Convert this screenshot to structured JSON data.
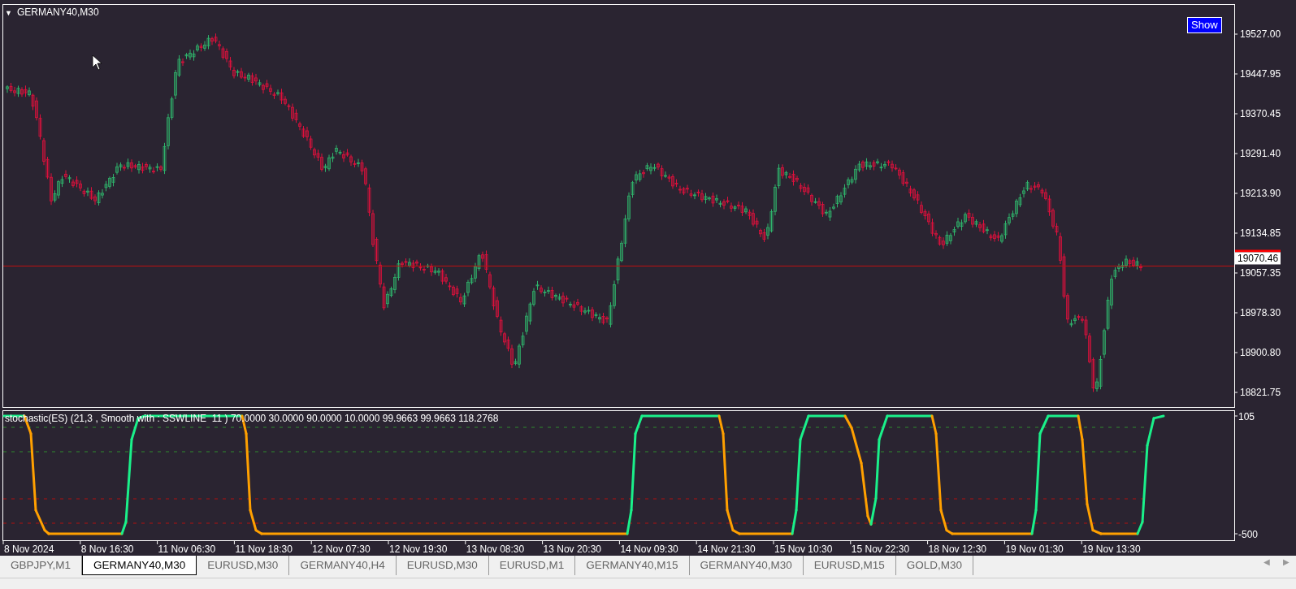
{
  "chart": {
    "collapse_glyph": "▼",
    "symbol_label": "GERMANY40,M30",
    "show_button": "Show",
    "price_ticks": [
      "19527.00",
      "19447.95",
      "19370.45",
      "19291.40",
      "19213.90",
      "19134.85",
      "19057.35",
      "18978.30",
      "18900.80",
      "18821.75"
    ],
    "current_price": "19070.46",
    "indicator": {
      "label": "stochastic(ES) (21,3 , Smooth with : SSWLINE  11 ) 70.0000 30.0000 90.0000 10.0000 99.9663 99.9663 118.2768",
      "ticks": [
        "105",
        "-500"
      ]
    },
    "time_ticks": [
      "8 Nov 2024",
      "8 Nov 16:30",
      "11 Nov 06:30",
      "11 Nov 18:30",
      "12 Nov 07:30",
      "12 Nov 19:30",
      "13 Nov 08:30",
      "13 Nov 20:30",
      "14 Nov 09:30",
      "14 Nov 21:30",
      "15 Nov 10:30",
      "15 Nov 22:30",
      "18 Nov 12:30",
      "19 Nov 01:30",
      "19 Nov 13:30"
    ]
  },
  "tabs": [
    {
      "label": "GBPJPY,M1",
      "selected": false
    },
    {
      "label": "GERMANY40,M30",
      "selected": true
    },
    {
      "label": "EURUSD,M30",
      "selected": false
    },
    {
      "label": "GERMANY40,H4",
      "selected": false
    },
    {
      "label": "EURUSD,M30",
      "selected": false
    },
    {
      "label": "EURUSD,M1",
      "selected": false
    },
    {
      "label": "GERMANY40,M15",
      "selected": false
    },
    {
      "label": "GERMANY40,M30",
      "selected": false
    },
    {
      "label": "EURUSD,M15",
      "selected": false
    },
    {
      "label": "GOLD,M30",
      "selected": false
    }
  ],
  "tab_scroll": [
    "◀",
    "▶"
  ]
}
